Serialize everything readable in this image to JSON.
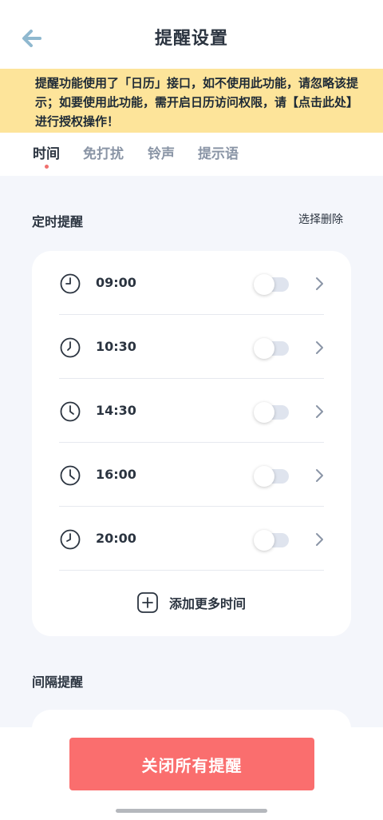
{
  "header": {
    "title": "提醒设置",
    "back_icon": "back-arrow-icon",
    "back_color": "#8fb8cf"
  },
  "notice": {
    "text": "提醒功能使用了「日历」接口，如不使用此功能，请忽略该提示；如要使用此功能，需开启日历访问权限，请【点击此处】进行授权操作！",
    "background": "#fde49a"
  },
  "tabs": [
    {
      "label": "时间",
      "active": true
    },
    {
      "label": "免打扰",
      "active": false
    },
    {
      "label": "铃声",
      "active": false
    },
    {
      "label": "提示语",
      "active": false
    }
  ],
  "scheduled": {
    "section_title": "定时提醒",
    "select_delete_label": "选择删除",
    "items": [
      {
        "time": "09:00",
        "enabled": false,
        "icon": "clock-icon"
      },
      {
        "time": "10:30",
        "enabled": false,
        "icon": "clock-icon"
      },
      {
        "time": "14:30",
        "enabled": false,
        "icon": "clock-icon"
      },
      {
        "time": "16:00",
        "enabled": false,
        "icon": "clock-icon"
      },
      {
        "time": "20:00",
        "enabled": false,
        "icon": "clock-icon"
      }
    ],
    "add_more_label": "添加更多时间"
  },
  "interval": {
    "section_title": "间隔提醒"
  },
  "bottom": {
    "close_all_label": "关闭所有提醒",
    "button_color": "#fa6e6e"
  },
  "colors": {
    "accent_dot": "#f0706e",
    "page_bg": "#f4f6fb",
    "text_primary": "#2b3440",
    "text_muted": "#8a95a6"
  }
}
